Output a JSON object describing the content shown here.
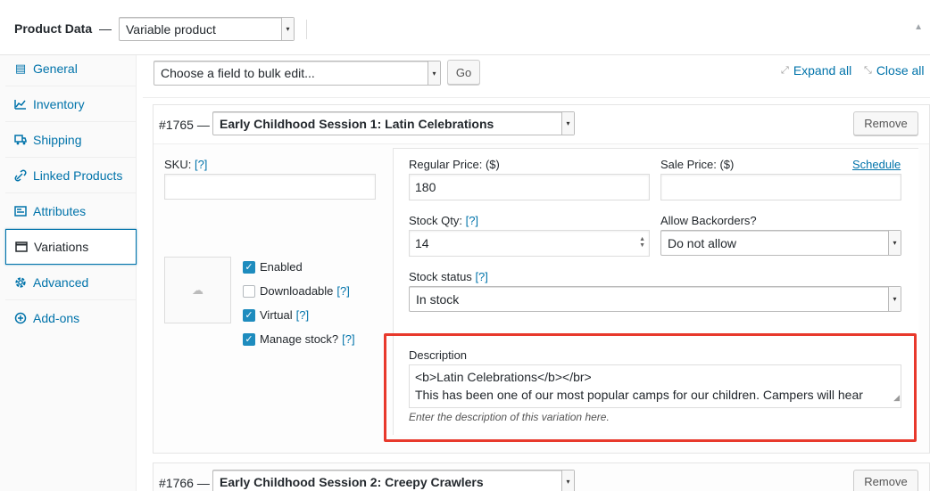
{
  "header": {
    "title": "Product Data",
    "dash": "—",
    "product_type": "Variable product"
  },
  "sidebar": {
    "items": [
      {
        "label": "General",
        "icon": "general-icon"
      },
      {
        "label": "Inventory",
        "icon": "inventory-icon"
      },
      {
        "label": "Shipping",
        "icon": "shipping-icon"
      },
      {
        "label": "Linked Products",
        "icon": "link-icon"
      },
      {
        "label": "Attributes",
        "icon": "attributes-icon"
      },
      {
        "label": "Variations",
        "icon": "variations-icon",
        "active": true
      },
      {
        "label": "Advanced",
        "icon": "gear-icon"
      },
      {
        "label": "Add-ons",
        "icon": "plus-circle-icon"
      }
    ]
  },
  "toolbar": {
    "bulk_edit_placeholder": "Choose a field to bulk edit...",
    "go_label": "Go",
    "expand_all": "Expand all",
    "close_all": "Close all"
  },
  "variations": [
    {
      "id": "#1765 —",
      "name": "Early Childhood Session 1: Latin Celebrations",
      "remove_label": "Remove",
      "sku_label": "SKU:",
      "help": "[?]",
      "sku_value": "",
      "checkboxes": [
        {
          "label": "Enabled",
          "checked": true
        },
        {
          "label": "Downloadable",
          "checked": false,
          "help": "[?]"
        },
        {
          "label": "Virtual",
          "checked": true,
          "help": "[?]"
        },
        {
          "label": "Manage stock?",
          "checked": true,
          "help": "[?]"
        }
      ],
      "regular_price_label": "Regular Price: ($)",
      "regular_price": "180",
      "sale_price_label": "Sale Price: ($)",
      "sale_price": "",
      "schedule_label": "Schedule",
      "stock_qty_label": "Stock Qty:",
      "stock_qty": "14",
      "backorders_label": "Allow Backorders?",
      "backorders_value": "Do not allow",
      "stock_status_label": "Stock status",
      "stock_status_value": "In stock",
      "description_label": "Description",
      "description_line1": "<b>Latin Celebrations</b></br>",
      "description_line2": "This has been one of our most popular camps for our children. Campers will hear",
      "description_hint": "Enter the description of this variation here."
    },
    {
      "id": "#1766 —",
      "name": "Early Childhood Session 2: Creepy Crawlers",
      "remove_label": "Remove"
    }
  ],
  "colors": {
    "accent": "#0073aa",
    "highlight": "#e8392c",
    "checkbox": "#1e8cbe"
  }
}
